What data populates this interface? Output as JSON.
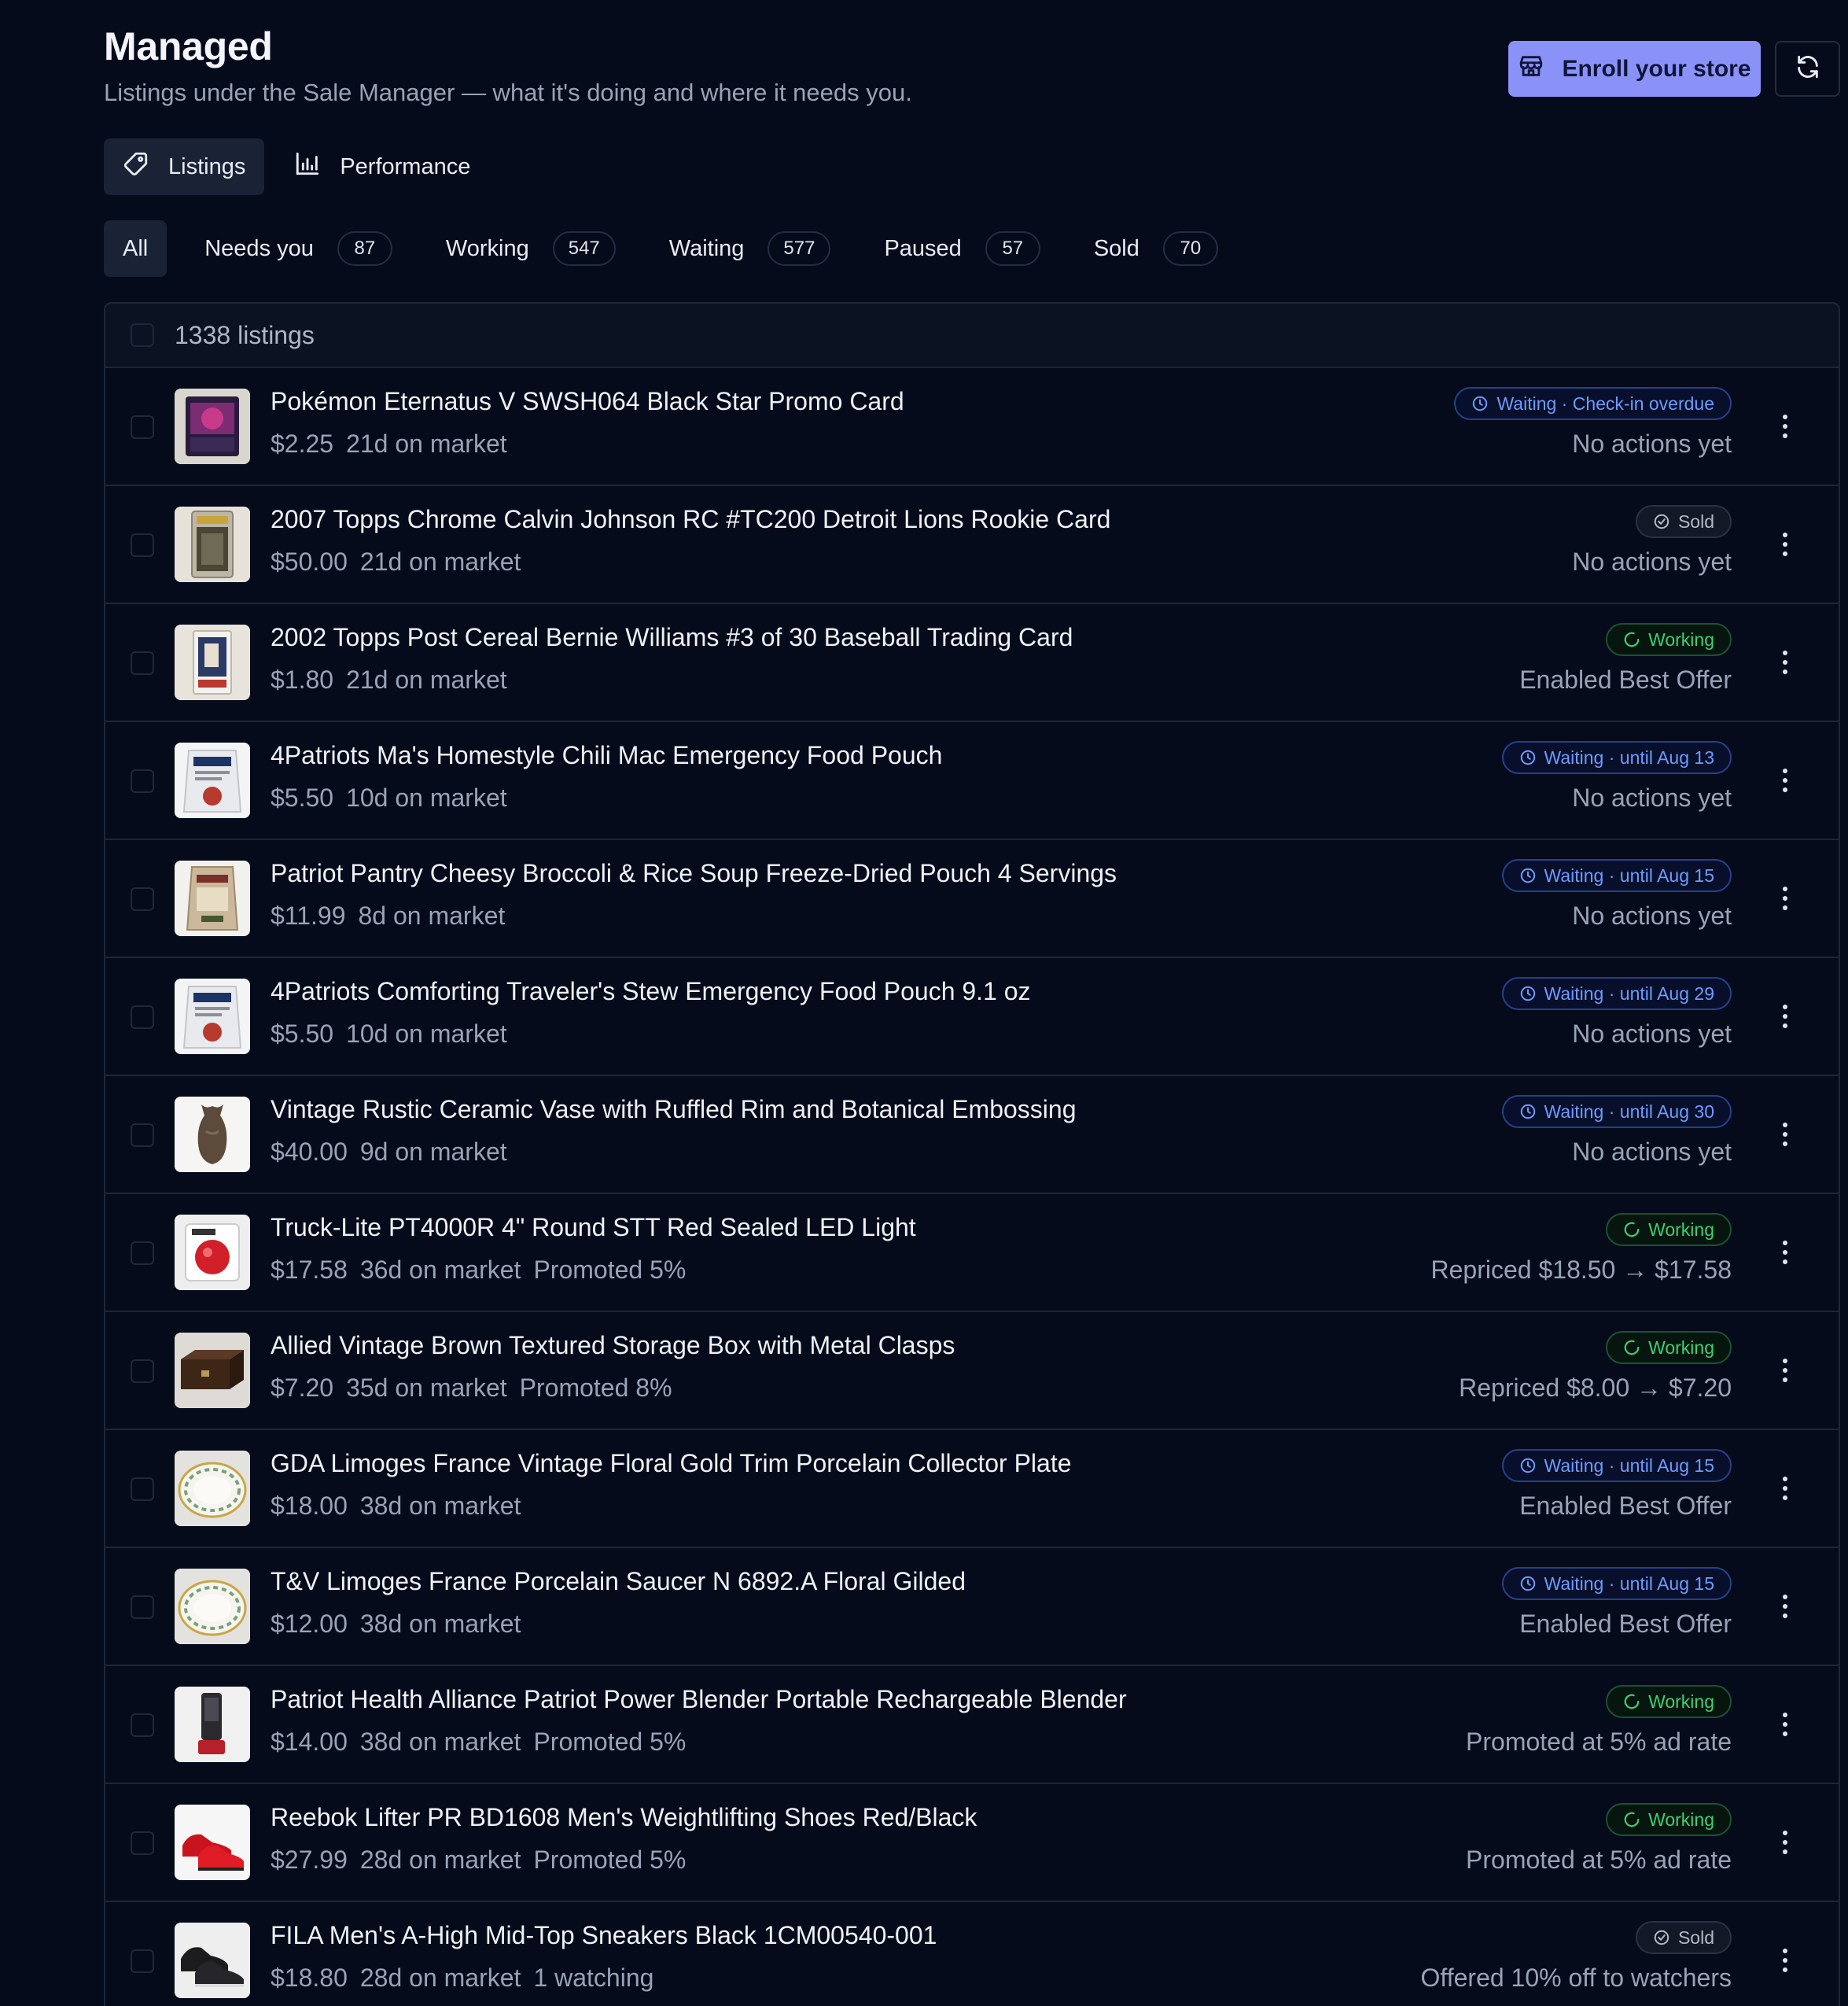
{
  "header": {
    "title": "Managed",
    "subtitle": "Listings under the Sale Manager — what it's doing and where it needs you.",
    "enroll_label": "Enroll your store",
    "accent": "#8b92f7"
  },
  "view_tabs": [
    {
      "label": "Listings",
      "icon": "tag-icon",
      "active": true
    },
    {
      "label": "Performance",
      "icon": "bar-chart-icon",
      "active": false
    }
  ],
  "filter_tabs": [
    {
      "label": "All",
      "count": "",
      "active": true
    },
    {
      "label": "Needs you",
      "count": "87"
    },
    {
      "label": "Working",
      "count": "547"
    },
    {
      "label": "Waiting",
      "count": "577"
    },
    {
      "label": "Paused",
      "count": "57"
    },
    {
      "label": "Sold",
      "count": "70"
    }
  ],
  "table": {
    "count_label": "1338 listings",
    "rows": [
      {
        "title": "Pokémon Eternatus V SWSH064 Black Star Promo Card",
        "price": "$2.25",
        "age": "21d on market",
        "extra": "",
        "status_type": "waiting",
        "status_label": "Waiting · Check-in overdue",
        "action": "No actions yet",
        "thumb": "card"
      },
      {
        "title": "2007 Topps Chrome Calvin Johnson RC #TC200 Detroit Lions Rookie Card",
        "price": "$50.00",
        "age": "21d on market",
        "extra": "",
        "status_type": "sold",
        "status_label": "Sold",
        "action": "No actions yet",
        "thumb": "slab"
      },
      {
        "title": "2002 Topps Post Cereal Bernie Williams #3 of 30 Baseball Trading Card",
        "price": "$1.80",
        "age": "21d on market",
        "extra": "",
        "status_type": "working",
        "status_label": "Working",
        "action": "Enabled Best Offer",
        "thumb": "card-light"
      },
      {
        "title": "4Patriots Ma's Homestyle Chili Mac Emergency Food Pouch",
        "price": "$5.50",
        "age": "10d on market",
        "extra": "",
        "status_type": "waiting",
        "status_label": "Waiting · until Aug 13",
        "action": "No actions yet",
        "thumb": "pouch"
      },
      {
        "title": "Patriot Pantry Cheesy Broccoli & Rice Soup Freeze-Dried Pouch 4 Servings",
        "price": "$11.99",
        "age": "8d on market",
        "extra": "",
        "status_type": "waiting",
        "status_label": "Waiting · until Aug 15",
        "action": "No actions yet",
        "thumb": "pouch-brown"
      },
      {
        "title": "4Patriots Comforting Traveler's Stew Emergency Food Pouch 9.1 oz",
        "price": "$5.50",
        "age": "10d on market",
        "extra": "",
        "status_type": "waiting",
        "status_label": "Waiting · until Aug 29",
        "action": "No actions yet",
        "thumb": "pouch"
      },
      {
        "title": "Vintage Rustic Ceramic Vase with Ruffled Rim and Botanical Embossing",
        "price": "$40.00",
        "age": "9d on market",
        "extra": "",
        "status_type": "waiting",
        "status_label": "Waiting · until Aug 30",
        "action": "No actions yet",
        "thumb": "vase"
      },
      {
        "title": "Truck-Lite PT4000R 4\" Round STT Red Sealed LED Light",
        "price": "$17.58",
        "age": "36d on market",
        "extra": "Promoted 5%",
        "status_type": "working",
        "status_label": "Working",
        "action": "Repriced $18.50 → $17.58",
        "thumb": "light"
      },
      {
        "title": "Allied Vintage Brown Textured Storage Box with Metal Clasps",
        "price": "$7.20",
        "age": "35d on market",
        "extra": "Promoted 8%",
        "status_type": "working",
        "status_label": "Working",
        "action": "Repriced $8.00 → $7.20",
        "thumb": "box"
      },
      {
        "title": "GDA Limoges France Vintage Floral Gold Trim Porcelain Collector Plate",
        "price": "$18.00",
        "age": "38d on market",
        "extra": "",
        "status_type": "waiting",
        "status_label": "Waiting · until Aug 15",
        "action": "Enabled Best Offer",
        "thumb": "plate"
      },
      {
        "title": "T&V Limoges France Porcelain Saucer N 6892.A Floral Gilded",
        "price": "$12.00",
        "age": "38d on market",
        "extra": "",
        "status_type": "waiting",
        "status_label": "Waiting · until Aug 15",
        "action": "Enabled Best Offer",
        "thumb": "plate"
      },
      {
        "title": "Patriot Health Alliance Patriot Power Blender Portable Rechargeable Blender",
        "price": "$14.00",
        "age": "38d on market",
        "extra": "Promoted 5%",
        "status_type": "working",
        "status_label": "Working",
        "action": "Promoted at 5% ad rate",
        "thumb": "blender"
      },
      {
        "title": "Reebok Lifter PR BD1608 Men's Weightlifting Shoes Red/Black",
        "price": "$27.99",
        "age": "28d on market",
        "extra": "Promoted 5%",
        "status_type": "working",
        "status_label": "Working",
        "action": "Promoted at 5% ad rate",
        "thumb": "shoes-red"
      },
      {
        "title": "FILA Men's A-High Mid-Top Sneakers Black 1CM00540-001",
        "price": "$18.80",
        "age": "28d on market",
        "extra": "1 watching",
        "status_type": "sold",
        "status_label": "Sold",
        "action": "Offered 10% off to watchers",
        "thumb": "shoes-black"
      }
    ]
  }
}
